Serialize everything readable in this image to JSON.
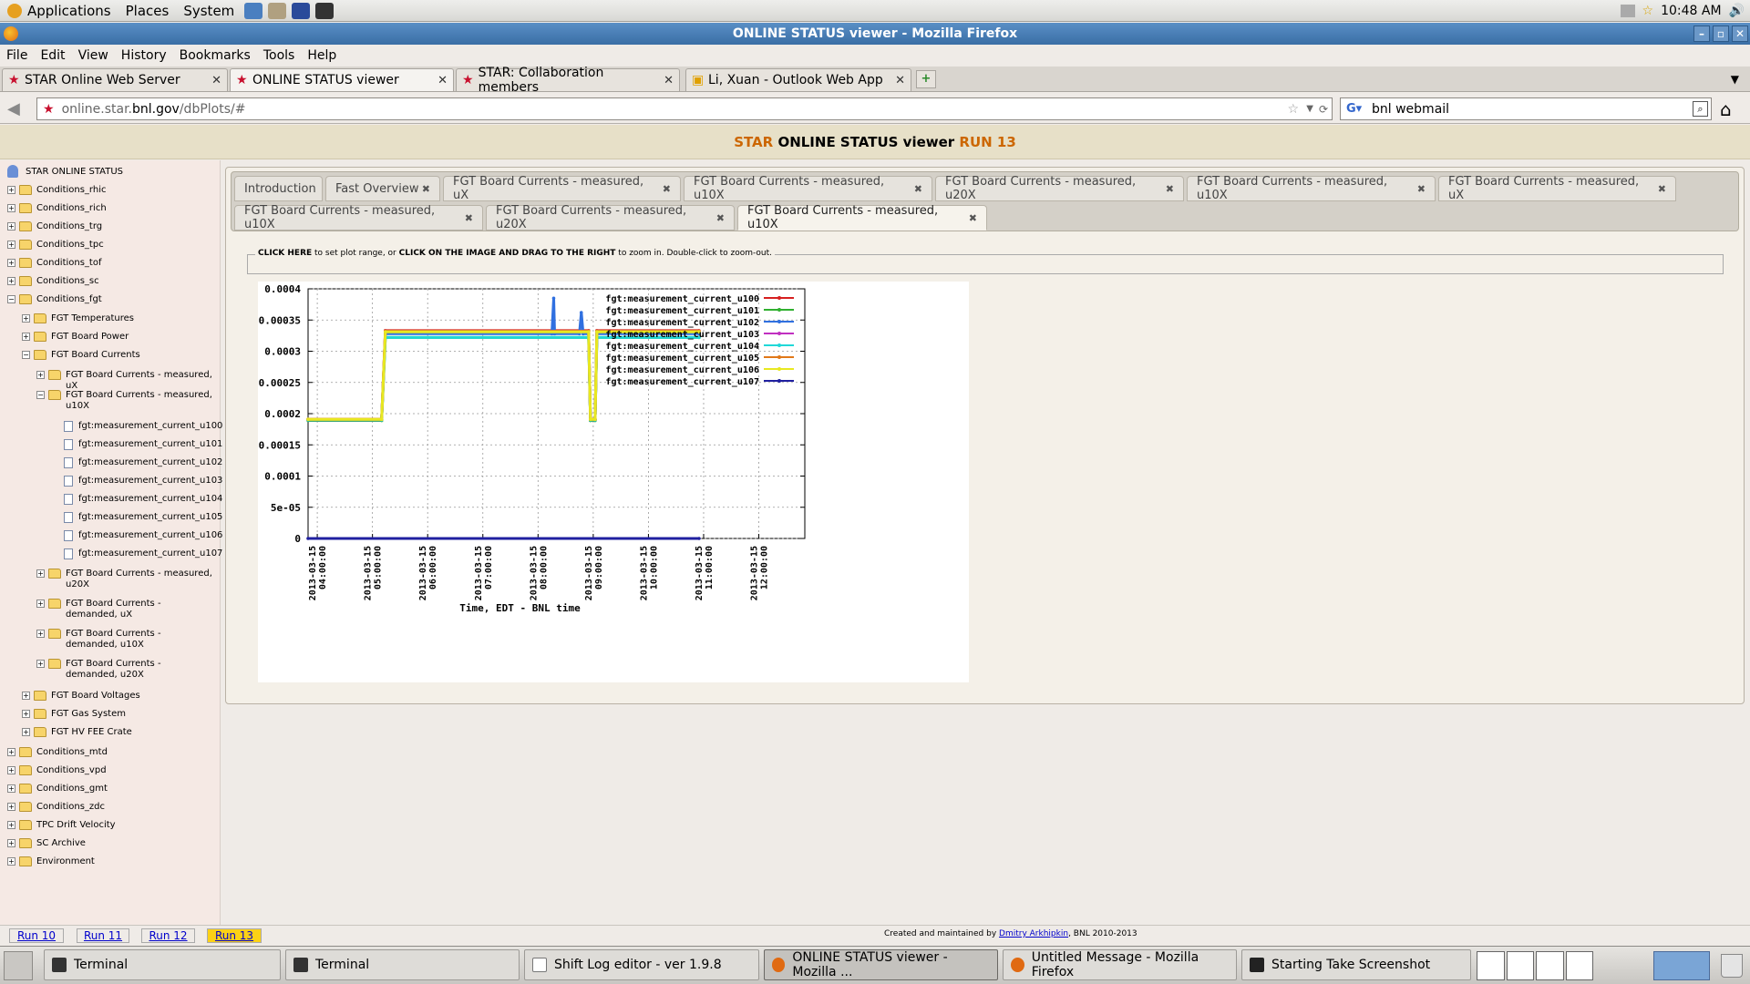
{
  "gnome": {
    "menus": [
      "Applications",
      "Places",
      "System"
    ],
    "clock": "10:48 AM"
  },
  "window": {
    "title": "ONLINE STATUS viewer - Mozilla Firefox"
  },
  "menubar": [
    "File",
    "Edit",
    "View",
    "History",
    "Bookmarks",
    "Tools",
    "Help"
  ],
  "browser_tabs": [
    {
      "label": "STAR Online Web Server"
    },
    {
      "label": "ONLINE STATUS viewer"
    },
    {
      "label": "STAR: Collaboration members"
    },
    {
      "label": "Li, Xuan - Outlook Web App"
    }
  ],
  "url": {
    "pre": "online.star.",
    "host": "bnl.gov",
    "post": "/dbPlots/#"
  },
  "search": {
    "value": "bnl webmail"
  },
  "header": {
    "star": "STAR",
    "middle": " ONLINE STATUS viewer ",
    "run": "RUN 13"
  },
  "tree": {
    "root": "STAR ONLINE STATUS",
    "items": [
      "Conditions_rhic",
      "Conditions_rich",
      "Conditions_trg",
      "Conditions_tpc",
      "Conditions_tof",
      "Conditions_sc",
      "Conditions_fgt",
      "FGT Temperatures",
      "FGT Board Power",
      "FGT Board Currents",
      "FGT Board Currents - measured, uX",
      "FGT Board Currents - measured, u10X",
      "fgt:measurement_current_u100",
      "fgt:measurement_current_u101",
      "fgt:measurement_current_u102",
      "fgt:measurement_current_u103",
      "fgt:measurement_current_u104",
      "fgt:measurement_current_u105",
      "fgt:measurement_current_u106",
      "fgt:measurement_current_u107",
      "FGT Board Currents - measured, u20X",
      "FGT Board Currents - demanded, uX",
      "FGT Board Currents - demanded, u10X",
      "FGT Board Currents - demanded, u20X",
      "FGT Board Voltages",
      "FGT Gas System",
      "FGT HV FEE Crate",
      "Conditions_mtd",
      "Conditions_vpd",
      "Conditions_gmt",
      "Conditions_zdc",
      "TPC Drift Velocity",
      "SC Archive",
      "Environment"
    ]
  },
  "page_tabs": [
    {
      "label": "Introduction"
    },
    {
      "label": "Fast Overview"
    },
    {
      "label": "FGT Board Currents - measured, uX"
    },
    {
      "label": "FGT Board Currents - measured, u10X"
    },
    {
      "label": "FGT Board Currents - measured, u20X"
    },
    {
      "label": "FGT Board Currents - measured, u10X"
    },
    {
      "label": "FGT Board Currents - measured, uX"
    },
    {
      "label": "FGT Board Currents - measured, u10X"
    },
    {
      "label": "FGT Board Currents - measured, u20X"
    },
    {
      "label": "FGT Board Currents - measured, u10X"
    }
  ],
  "close_glyph": "✖",
  "instructions": {
    "b1": "CLICK HERE",
    "t1": " to set plot range, or ",
    "b2": "CLICK ON THE IMAGE AND DRAG TO THE RIGHT",
    "t2": " to zoom in. Double-click to zoom-out."
  },
  "chart_data": {
    "type": "line",
    "xlabel": "Time, EDT - BNL time",
    "ylabel": "",
    "x_ticks": [
      "2013-03-15 04:00:00",
      "2013-03-15 05:00:00",
      "2013-03-15 06:00:00",
      "2013-03-15 07:00:00",
      "2013-03-15 08:00:00",
      "2013-03-15 09:00:00",
      "2013-03-15 10:00:00",
      "2013-03-15 11:00:00",
      "2013-03-15 12:00:00"
    ],
    "xlim": [
      "2013-03-15 03:50:00",
      "2013-03-15 12:50:00"
    ],
    "y_ticks": [
      "0",
      "5e-05",
      "0.0001",
      "0.00015",
      "0.0002",
      "0.00025",
      "0.0003",
      "0.00035",
      "0.0004"
    ],
    "ylim": [
      0,
      0.0004
    ],
    "grid": true,
    "legend_position": "top-right",
    "series": [
      {
        "name": "fgt:measurement_current_u100",
        "color": "#d62020",
        "points": [
          [
            "03:50",
            0.000191
          ],
          [
            "05:10",
            0.000191
          ],
          [
            "05:14",
            0.000333
          ],
          [
            "08:55",
            0.000333
          ],
          [
            "08:57",
            0.000191
          ],
          [
            "09:02",
            0.000191
          ],
          [
            "09:04",
            0.000333
          ],
          [
            "10:55",
            0.000333
          ]
        ]
      },
      {
        "name": "fgt:measurement_current_u101",
        "color": "#30b030",
        "points": [
          [
            "03:50",
            0.000189
          ],
          [
            "05:10",
            0.000189
          ],
          [
            "05:14",
            0.000322
          ],
          [
            "08:55",
            0.000322
          ],
          [
            "08:57",
            0.000189
          ],
          [
            "09:02",
            0.000189
          ],
          [
            "09:04",
            0.000322
          ],
          [
            "10:55",
            0.000322
          ]
        ]
      },
      {
        "name": "fgt:measurement_current_u102",
        "color": "#3070e0",
        "points": [
          [
            "03:50",
            0.00019
          ],
          [
            "05:10",
            0.00019
          ],
          [
            "05:14",
            0.000328
          ],
          [
            "08:15",
            0.000328
          ],
          [
            "08:17",
            0.000385
          ],
          [
            "08:18",
            0.000328
          ],
          [
            "08:45",
            0.000328
          ],
          [
            "08:47",
            0.000362
          ],
          [
            "08:49",
            0.000328
          ],
          [
            "08:55",
            0.000328
          ],
          [
            "08:57",
            0.00019
          ],
          [
            "09:02",
            0.00019
          ],
          [
            "09:04",
            0.000328
          ],
          [
            "10:55",
            0.000328
          ]
        ]
      },
      {
        "name": "fgt:measurement_current_u103",
        "color": "#c030c0",
        "points": [
          [
            "03:50",
            0.00019
          ],
          [
            "05:10",
            0.00019
          ],
          [
            "05:14",
            0.000332
          ],
          [
            "08:55",
            0.000332
          ],
          [
            "08:57",
            0.00019
          ],
          [
            "09:02",
            0.00019
          ],
          [
            "09:04",
            0.000332
          ],
          [
            "10:55",
            0.000332
          ]
        ]
      },
      {
        "name": "fgt:measurement_current_u104",
        "color": "#20d8d8",
        "points": [
          [
            "03:50",
            0.00019
          ],
          [
            "05:10",
            0.00019
          ],
          [
            "05:14",
            0.000322
          ],
          [
            "08:55",
            0.000322
          ],
          [
            "08:57",
            0.00019
          ],
          [
            "09:02",
            0.00019
          ],
          [
            "09:04",
            0.000322
          ],
          [
            "10:55",
            0.000322
          ]
        ]
      },
      {
        "name": "fgt:measurement_current_u105",
        "color": "#e07818",
        "points": [
          [
            "03:50",
            0.000191
          ],
          [
            "05:10",
            0.000191
          ],
          [
            "05:14",
            0.000332
          ],
          [
            "08:55",
            0.000332
          ],
          [
            "08:57",
            0.000191
          ],
          [
            "09:02",
            0.000191
          ],
          [
            "09:04",
            0.000332
          ],
          [
            "10:55",
            0.000332
          ]
        ]
      },
      {
        "name": "fgt:measurement_current_u106",
        "color": "#e8e820",
        "points": [
          [
            "03:50",
            0.000191
          ],
          [
            "05:10",
            0.000191
          ],
          [
            "05:14",
            0.000331
          ],
          [
            "08:55",
            0.000331
          ],
          [
            "08:57",
            0.000191
          ],
          [
            "09:02",
            0.000191
          ],
          [
            "09:04",
            0.000331
          ],
          [
            "10:55",
            0.000331
          ]
        ]
      },
      {
        "name": "fgt:measurement_current_u107",
        "color": "#2020a0",
        "points": [
          [
            "03:50",
            0.0
          ],
          [
            "10:55",
            0.0
          ]
        ]
      }
    ]
  },
  "runs": [
    "Run 10",
    "Run 11",
    "Run 12",
    "Run 13"
  ],
  "credit": {
    "pre": "Created and maintained by ",
    "link": "Dmitry Arkhipkin",
    "post": ", BNL 2010-2013"
  },
  "taskbar": [
    {
      "label": "Terminal"
    },
    {
      "label": "Terminal"
    },
    {
      "label": "Shift Log editor - ver 1.9.8"
    },
    {
      "label": "ONLINE STATUS viewer - Mozilla ..."
    },
    {
      "label": "Untitled Message - Mozilla Firefox"
    },
    {
      "label": "Starting Take Screenshot"
    }
  ]
}
